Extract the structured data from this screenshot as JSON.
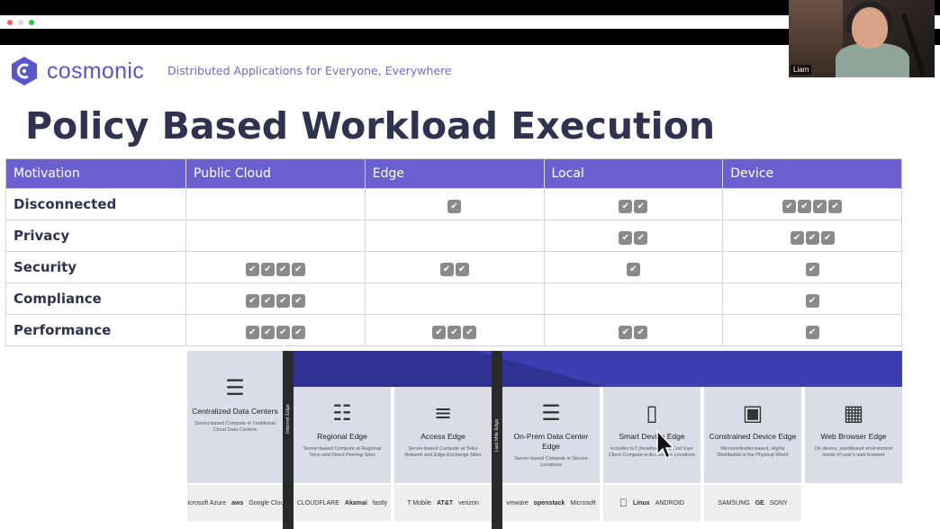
{
  "brand": {
    "name": "cosmonic",
    "tagline": "Distributed Applications for Everyone, Everywhere",
    "color": "#5a55c8"
  },
  "slide": {
    "title": "Policy Based Workload Execution"
  },
  "webcam": {
    "name": "Liam"
  },
  "table": {
    "header_color": "#6a60d0",
    "columns": [
      "Motivation",
      "Public Cloud",
      "Edge",
      "Local",
      "Device"
    ],
    "rows": [
      {
        "label": "Disconnected",
        "checks": [
          0,
          1,
          2,
          4
        ]
      },
      {
        "label": "Privacy",
        "checks": [
          0,
          0,
          2,
          3
        ]
      },
      {
        "label": "Security",
        "checks": [
          4,
          2,
          1,
          1
        ]
      },
      {
        "label": "Compliance",
        "checks": [
          4,
          0,
          0,
          1
        ]
      },
      {
        "label": "Performance",
        "checks": [
          4,
          3,
          2,
          1
        ]
      }
    ]
  },
  "diagram": {
    "separators": [
      "Internet Edge",
      "Last Mile Edge"
    ],
    "panels": [
      {
        "icon": "server-rack-icon",
        "title": "Centralized Data Centers",
        "desc": "Server-based Compute in Traditional Cloud Data Centers"
      },
      {
        "icon": "server-icon",
        "title": "Regional Edge",
        "desc": "Server-based Compute at Regional Telco and Direct Peering Sites"
      },
      {
        "icon": "tower-server-icon",
        "title": "Access Edge",
        "desc": "Server-based Compute at Telco Network and Edge Exchange Sites"
      },
      {
        "icon": "server-stack-icon",
        "title": "On-Prem Data Center Edge",
        "desc": "Server-based Compute in Secure Locations"
      },
      {
        "icon": "phone-router-icon",
        "title": "Smart Device Edge",
        "desc": "Includes IoT (headless) and End User Client Compute in Accessible Locations"
      },
      {
        "icon": "microcontroller-icon",
        "title": "Constrained Device Edge",
        "desc": "Microcontroller-based, Highly Distributed in the Physical World"
      },
      {
        "icon": "browser-globe-icon",
        "title": "Web Browser Edge",
        "desc": "On device, sandboxed environment inside of user's web browser"
      }
    ],
    "logos": [
      [
        "Microsoft Azure",
        "aws",
        "Google Cloud"
      ],
      [
        "CLOUDFLARE",
        "Akamai",
        "fastly"
      ],
      [
        "T Mobile",
        "AT&T",
        "verizon"
      ],
      [
        "vmware",
        "openstack",
        "Microsoft"
      ],
      [
        "",
        "Linux",
        "ANDROID"
      ],
      [
        "SAMSUNG",
        "GE",
        "SONY"
      ]
    ]
  }
}
